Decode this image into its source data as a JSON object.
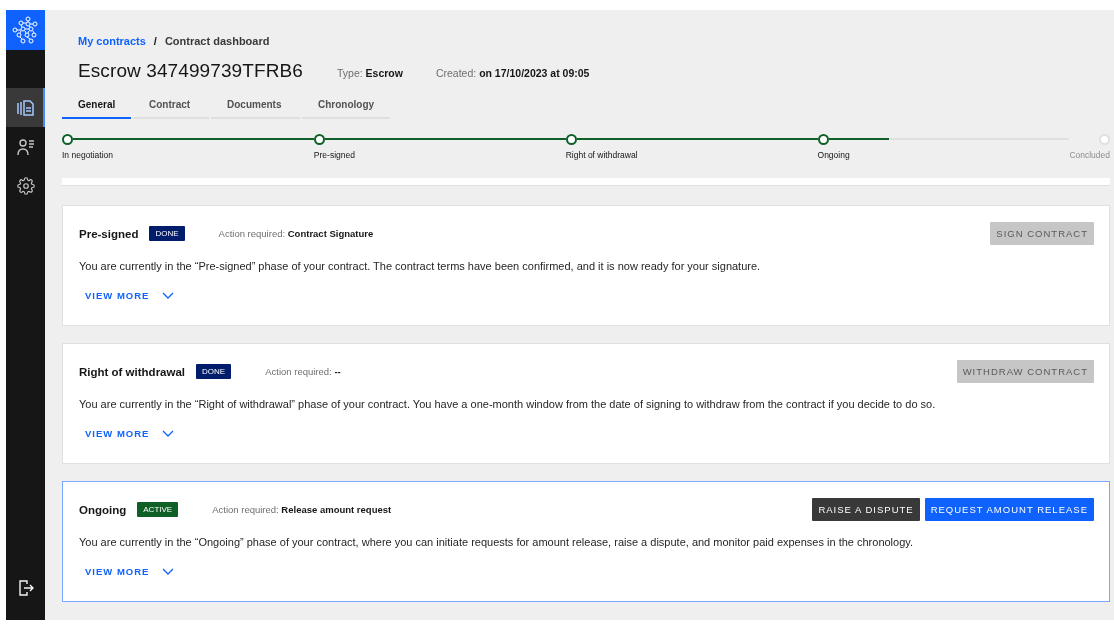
{
  "breadcrumb": [
    {
      "label": "My contracts",
      "link": true
    },
    {
      "label": "Contract dashboard",
      "link": false
    }
  ],
  "breadcrumb_separator": "/",
  "title": "Escrow 347499739TFRB6",
  "meta": [
    {
      "label": "Type:",
      "value": "Escrow"
    },
    {
      "label": "Created:",
      "value": "on 17/10/2023 at 09:05"
    }
  ],
  "tabs": [
    {
      "label": "General",
      "selected": true
    },
    {
      "label": "Contract",
      "selected": false
    },
    {
      "label": "Documents",
      "selected": false
    },
    {
      "label": "Chronology",
      "selected": false
    }
  ],
  "sidebar": {
    "items": [
      {
        "kind": "contracts",
        "selected": true
      },
      {
        "kind": "users",
        "selected": false
      },
      {
        "kind": "settings",
        "selected": false
      }
    ]
  },
  "progress": {
    "steps": [
      {
        "label": "In negotiation",
        "completed": true
      },
      {
        "label": "Pre-signed",
        "completed": true
      },
      {
        "label": "Right of withdrawal",
        "completed": true
      },
      {
        "label": "Ongoing",
        "completed": true
      },
      {
        "label": "Concluded",
        "completed": false
      }
    ]
  },
  "phases": [
    {
      "title": "Pre-signed",
      "status": {
        "label": "DONE",
        "kind": "done"
      },
      "action_label": "Action required:",
      "action": "Contract Signature",
      "selected": false,
      "buttons": [
        {
          "label": "SIGN CONTRACT",
          "kind": "disabled"
        }
      ],
      "description": "You are currently in the “Pre-signed” phase of your contract. The contract terms have been confirmed, and it is now ready for your signature.",
      "view_more": "VIEW MORE"
    },
    {
      "title": "Right of withdrawal",
      "status": {
        "label": "DONE",
        "kind": "done"
      },
      "action_label": "Action required:",
      "action": "--",
      "selected": false,
      "buttons": [
        {
          "label": "WITHDRAW CONTRACT",
          "kind": "disabled"
        }
      ],
      "description": "You are currently in the “Right of withdrawal” phase of your contract. You have a one-month window from the date of signing to withdraw from the contract if you decide to do so.",
      "view_more": "VIEW MORE"
    },
    {
      "title": "Ongoing",
      "status": {
        "label": "ACTIVE",
        "kind": "active"
      },
      "action_label": "Action required:",
      "action": "Release amount request",
      "selected": true,
      "buttons": [
        {
          "label": "RAISE A DISPUTE",
          "kind": "secondary"
        },
        {
          "label": "REQUEST AMOUNT RELEASE",
          "kind": "primary"
        }
      ],
      "description": "You are currently in the “Ongoing” phase of your contract, where you can initiate requests for amount release, raise a dispute, and monitor paid expenses in the chronology.",
      "view_more": "VIEW MORE"
    }
  ]
}
